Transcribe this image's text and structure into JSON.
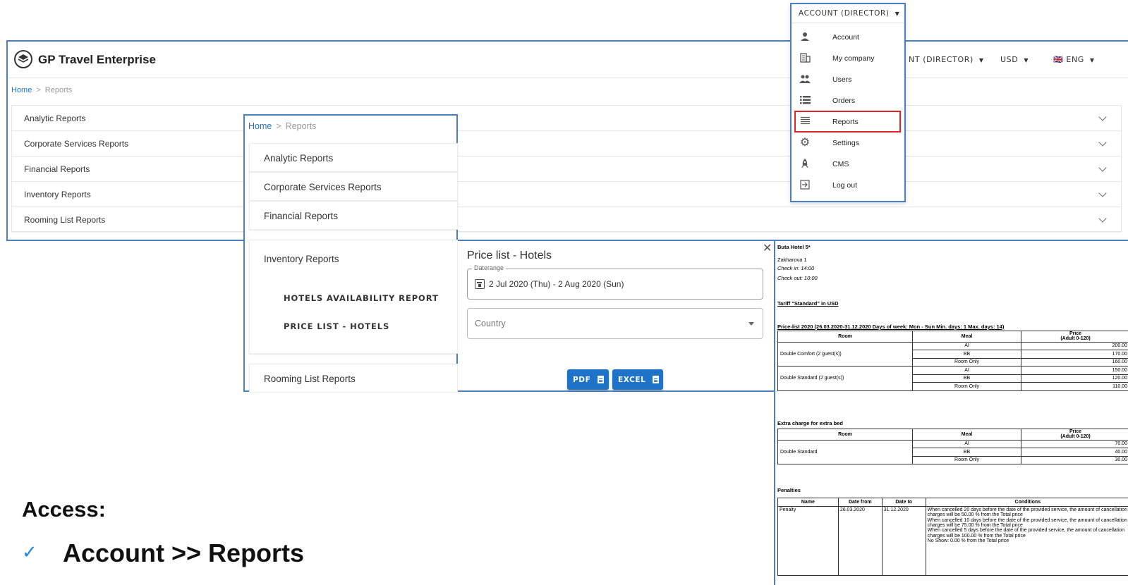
{
  "app": {
    "title": "GP Travel Enterprise"
  },
  "header": {
    "account_label": "ACCOUNT (DIRECTOR)",
    "account_partial": "NT (DIRECTOR)",
    "currency": "USD",
    "language": "ENG",
    "flag": "🇬🇧"
  },
  "breadcrumb": {
    "home": "Home",
    "sep": ">",
    "current": "Reports"
  },
  "reports": [
    "Analytic Reports",
    "Corporate Services Reports",
    "Financial Reports",
    "Inventory Reports",
    "Rooming List Reports"
  ],
  "dropdown": {
    "title": "ACCOUNT (DIRECTOR)",
    "items": [
      {
        "label": "Account",
        "icon": "person-icon"
      },
      {
        "label": "My company",
        "icon": "building-icon"
      },
      {
        "label": "Users",
        "icon": "users-icon"
      },
      {
        "label": "Orders",
        "icon": "list-icon"
      },
      {
        "label": "Reports",
        "icon": "lines-icon"
      },
      {
        "label": "Settings",
        "icon": "gear-icon"
      },
      {
        "label": "CMS",
        "icon": "rocket-icon"
      },
      {
        "label": "Log out",
        "icon": "logout-icon"
      }
    ]
  },
  "inventory_sub": [
    "HOTELS AVAILABILITY REPORT",
    "PRICE LIST - HOTELS"
  ],
  "price_list_form": {
    "title": "Price list - Hotels",
    "daterange_label": "Daterange",
    "daterange_value": "2 Jul 2020 (Thu) - 2 Aug 2020 (Sun)",
    "country_placeholder": "Country",
    "pdf_label": "PDF",
    "excel_label": "EXCEL"
  },
  "doc": {
    "hotel": "Buta Hotel 5*",
    "address": "Zakharova 1",
    "checkin": "Check in: 14:00",
    "checkout": "Check out: 10:00",
    "tariff": "Tariff \"Standard\" in USD",
    "pricelist_title": "Price-list 2020 (26.03.2020-31.12.2020 Days of week: Mon - Sun Min. days: 1 Max. days: 14)",
    "col_room": "Room",
    "col_meal": "Meal",
    "col_price": "Price",
    "col_price_sub": "(Adult 0-120)",
    "room1": "Double Comfort (2 guest(s))",
    "room2": "Double Standard (2 guest(s))",
    "meals": [
      "AI",
      "BB",
      "Room Only"
    ],
    "prices1": [
      "200.00",
      "170.00",
      "160.00"
    ],
    "prices2": [
      "150.00",
      "120.00",
      "110.00"
    ],
    "extra_title": "Extra charge for extra bed",
    "extra_room": "Double Standard",
    "extra_prices": [
      "70.00",
      "40.00",
      "30.00"
    ],
    "penalties_title": "Penalties",
    "pen_cols": [
      "Name",
      "Date from",
      "Date to",
      "Conditions"
    ],
    "pen_name": "Penalty",
    "pen_from": "26.03.2020",
    "pen_to": "31.12.2020",
    "pen_cond": [
      "When cancelled 20 days before the date of the provided service, the amount of cancellation charges will be 50.00 % from the Total price",
      "When cancelled 10 days before the date of the provided service, the amount of cancellation charges will be 75.00 % from the Total price",
      "When cancelled 5 days before the date of the provided service, the amount of cancellation charges will be 100.00 % from the Total price",
      "No Show: 0.00 % from the Total price"
    ]
  },
  "access": {
    "title": "Access:",
    "check": "✓",
    "path": "Account >> Reports"
  }
}
